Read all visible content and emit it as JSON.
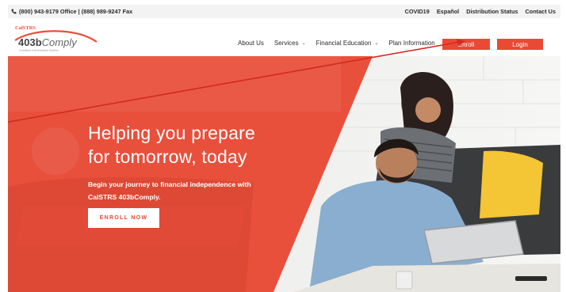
{
  "topbar": {
    "contact": "(800) 943-9179 Office | (888) 989-9247 Fax",
    "links": [
      "COVID19",
      "Español",
      "Distribution Status",
      "Contact Us"
    ]
  },
  "logo": {
    "brand_small": "CalSTRS",
    "name_bold": "403b",
    "name_light": "Comply",
    "tagline": "Compliance & Administration Solutions"
  },
  "nav": {
    "about": "About Us",
    "services": "Services",
    "financial_education": "Financial Education",
    "plan_information": "Plan Information",
    "enroll": "Enroll",
    "login": "Login"
  },
  "hero": {
    "title_line1": "Helping you prepare",
    "title_line2": "for tomorrow, today",
    "subtitle": "Begin your journey to financial independence with CalSTRS 403bComply.",
    "cta": "ENROLL NOW"
  },
  "colors": {
    "brand_red": "#ea4a34",
    "overlay_red": "#e8503c",
    "topbar_bg": "#f3f3f3",
    "text_dark": "#2b2b2b"
  },
  "icons": {
    "phone": "phone-icon",
    "chevron": "chevron-down-icon",
    "arrow": "annotation-arrow"
  }
}
